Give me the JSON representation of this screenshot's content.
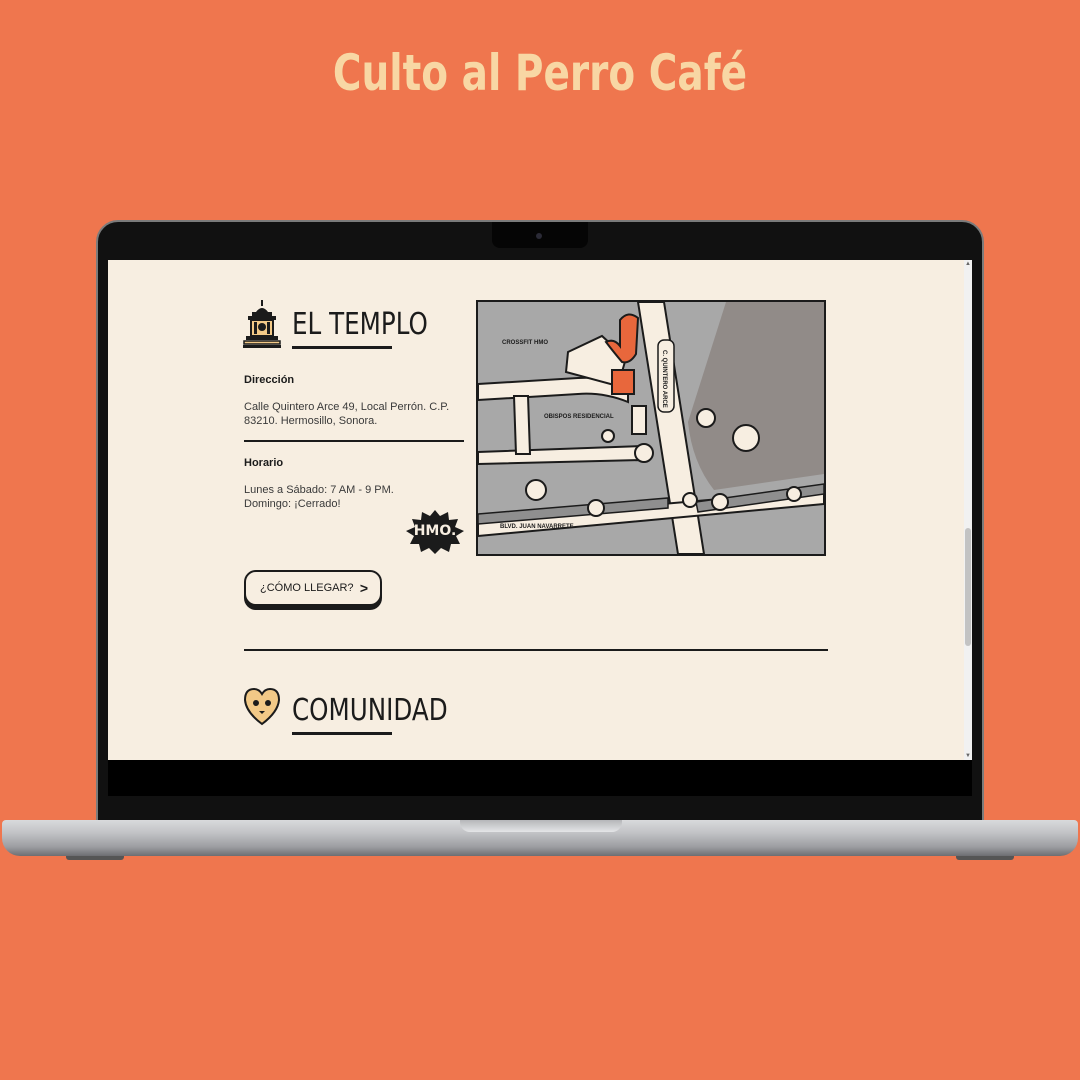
{
  "banner": {
    "title": "Culto al Perro Café"
  },
  "templo": {
    "title": "EL TEMPLO",
    "address_label": "Dirección",
    "address_line1": "Calle Quintero Arce 49, Local Perrón. C.P.",
    "address_line2": "83210. Hermosillo, Sonora.",
    "hours_label": "Horario",
    "hours_line1": "Lunes a Sábado: 7 AM - 9 PM.",
    "hours_line2": "Domingo: ¡Cerrado!",
    "badge_text": "HMO.",
    "button_label": "¿CÓMO LLEGAR?"
  },
  "map": {
    "label_crossfit": "CROSSFIT HMO",
    "label_obispos": "OBISPOS RESIDENCIAL",
    "label_quintero": "C. QUINTERO ARCE",
    "label_navarrete": "BLVD. JUAN NAVARRETE"
  },
  "comunidad": {
    "title": "COMUNIDAD"
  },
  "colors": {
    "background": "#EF764E",
    "title": "#F8D7A4",
    "page": "#F7EEE1",
    "ink": "#1B1B1B",
    "accent": "#E8673C"
  }
}
